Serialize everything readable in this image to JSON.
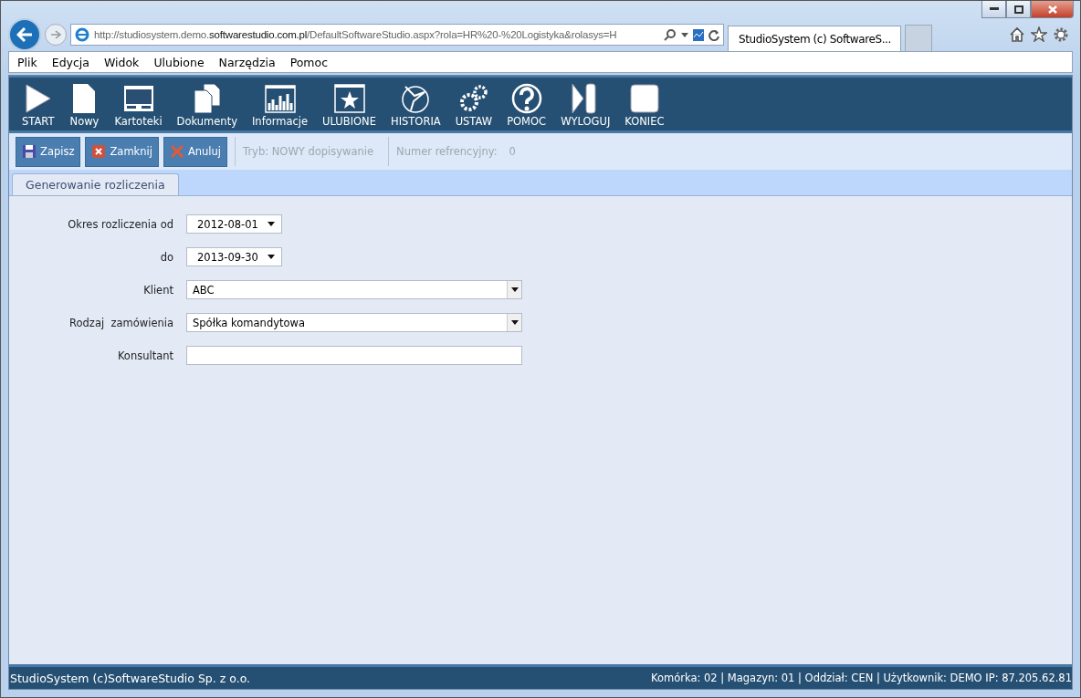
{
  "browser": {
    "address": "http://studiosystem.demo.",
    "address_domain": "softwarestudio.com.pl",
    "address_rest": "/DefaultSoftwareStudio.aspx?rola=HR%20-%20Logistyka&rolasys=H",
    "tab_title": "StudioSystem (c) SoftwareS..."
  },
  "menu": [
    "Plik",
    "Edycja",
    "Widok",
    "Ulubione",
    "Narzędzia",
    "Pomoc"
  ],
  "toolbar": [
    {
      "kind": "play",
      "label": "START"
    },
    {
      "kind": "page",
      "label": "Nowy"
    },
    {
      "kind": "window",
      "label": "Kartoteki"
    },
    {
      "kind": "pages",
      "label": "Dokumenty"
    },
    {
      "kind": "chart",
      "label": "Informacje"
    },
    {
      "kind": "star",
      "label": "ULUBIONE"
    },
    {
      "kind": "history",
      "label": "HISTORIA"
    },
    {
      "kind": "gears",
      "label": "USTAW"
    },
    {
      "kind": "help",
      "label": "POMOC"
    },
    {
      "kind": "logout",
      "label": "WYLOGUJ"
    },
    {
      "kind": "stop",
      "label": "KONIEC"
    }
  ],
  "actions": [
    {
      "kind": "save",
      "label": "Zapisz"
    },
    {
      "kind": "close",
      "label": "Zamknij"
    },
    {
      "kind": "cancel",
      "label": "Anuluj"
    }
  ],
  "mode": "Tryb: NOWY dopisywanie",
  "reference_label": "Numer refrencyjny:",
  "reference_value": "0",
  "tabs": [
    {
      "label": "Generowanie rozliczenia",
      "selected": true
    }
  ],
  "form": [
    {
      "kind": "date",
      "label": "Okres rozliczenia od",
      "value": "2012-08-01"
    },
    {
      "kind": "date",
      "label": "do",
      "value": "2013-09-30"
    },
    {
      "kind": "combo",
      "label": "Klient",
      "value": "ABC"
    },
    {
      "kind": "combo",
      "label": "Rodzaj  zamówienia",
      "value": "Spółka komandytowa"
    },
    {
      "kind": "text",
      "label": "Konsultant"
    }
  ],
  "status_bar": {
    "left": "StudioSystem (c)SoftwareStudio Sp. z o.o.",
    "right": "Komórka: 02 | Magazyn: 01 | Oddział: CEN | Użytkownik: DEMO IP: 87.205.62.81"
  }
}
